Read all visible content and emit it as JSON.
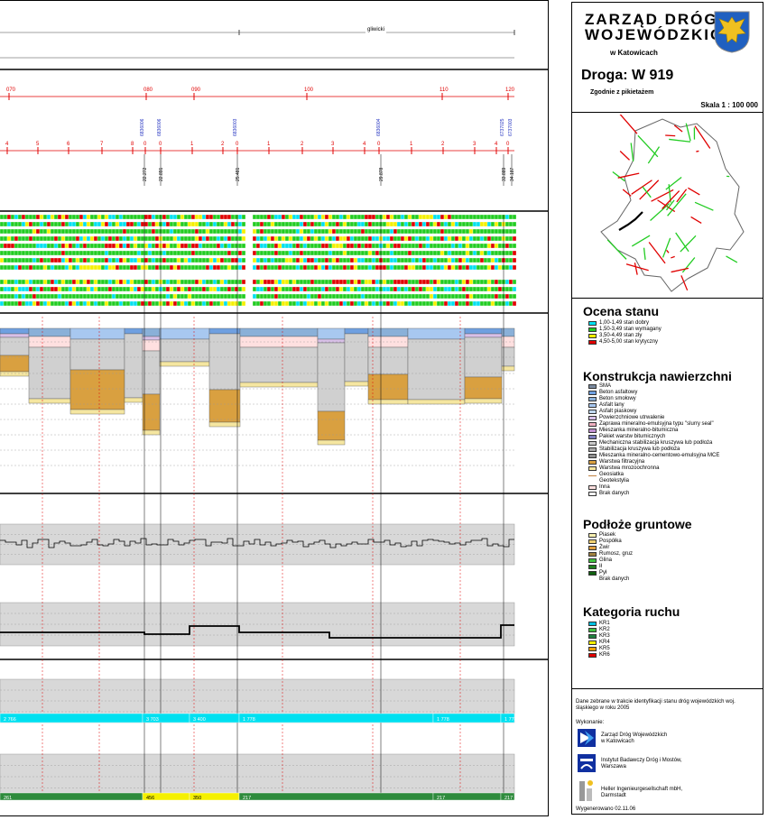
{
  "header": {
    "road_name": "gliwicki"
  },
  "stations": [
    "070",
    "080",
    "090",
    "100",
    "110",
    "120"
  ],
  "refpoints": [
    "6836006",
    "6836006",
    "6836003",
    "6836004",
    "6737025",
    "6737003"
  ],
  "km_ticks": [
    "4",
    "5",
    "6",
    "7",
    "8",
    "0",
    "0",
    "1",
    "2",
    "0",
    "1",
    "2",
    "3",
    "4",
    "0",
    "1",
    "2",
    "3",
    "4",
    "0"
  ],
  "distances": [
    "22.272",
    "22.891",
    "25.481",
    "29.878",
    "33.889",
    "34.187"
  ],
  "traffic_values": [
    {
      "label": "2 766",
      "color": "#00e0f0"
    },
    {
      "label": "3 703",
      "color": "#00e0f0"
    },
    {
      "label": "3 400",
      "color": "#00e0f0"
    },
    {
      "label": "1 778",
      "color": "#00e0f0"
    },
    {
      "label": "1 778",
      "color": "#00e0f0"
    },
    {
      "label": "1 778",
      "color": "#00e0f0"
    }
  ],
  "heavy_values": [
    {
      "label": "261",
      "color": "#2e8b3c"
    },
    {
      "label": "456",
      "color": "#f5f000"
    },
    {
      "label": "350",
      "color": "#f5f000"
    },
    {
      "label": "217",
      "color": "#2e8b3c"
    },
    {
      "label": "217",
      "color": "#2e8b3c"
    },
    {
      "label": "217",
      "color": "#2e8b3c"
    }
  ],
  "legend": {
    "org_line1": "ZARZĄD  DRÓG",
    "org_line2": "WOJEWÓDZKICH",
    "org_city": "w Katowicach",
    "road_title": "Droga:  W 919",
    "chainage_note": "Zgodnie z pikietażem",
    "scale": "Skala 1 : 100 000",
    "condition": {
      "title": "Ocena stanu",
      "items": [
        {
          "label": "1,00-1,49 stan dobry",
          "color": "#00e0f0"
        },
        {
          "label": "1,50-3,49 stan wymagany",
          "color": "#22cc22"
        },
        {
          "label": "3,50-4,49 stan zły",
          "color": "#f5f000"
        },
        {
          "label": "4,50-5,00 stan krytyczny",
          "color": "#e00000"
        }
      ]
    },
    "construction": {
      "title": "Konstrukcja nawierzchni",
      "items": [
        {
          "label": "SMA",
          "color": "#7a8aa0"
        },
        {
          "label": "Beton asfaltowy",
          "color": "#6fa0e0"
        },
        {
          "label": "Beton smołowy",
          "color": "#8ab0d8"
        },
        {
          "label": "Asfalt lany",
          "color": "#a8c8f0"
        },
        {
          "label": "Asfalt piaskowy",
          "color": "#c0d8f0"
        },
        {
          "label": "Powierzchniowe utrwalenie",
          "color": "#d8c0e8"
        },
        {
          "label": "Zaprawa mineralno-emulsyjna typu \"slurry seal\"",
          "color": "#f0b0c0"
        },
        {
          "label": "Mieszanka mineralno-bitumiczna",
          "color": "#c090d0"
        },
        {
          "label": "Pakiet warstw bitumicznych",
          "color": "#8080c0"
        },
        {
          "label": "Mechaniczna stabilizacja kruszywa lub podłoża",
          "color": "#c8c8c8"
        },
        {
          "label": "Stabilizacja kruszywa lub podłoża",
          "color": "#a8a8a8"
        },
        {
          "label": "Mieszanka mineralno-cementowo-emulsyjna MCE",
          "color": "#909090"
        },
        {
          "label": "Warstwa filtracyjna",
          "color": "#d9a040"
        },
        {
          "label": "Warstwa mrozoochronna",
          "color": "#f5e6a0"
        },
        {
          "label": "Geosiatka",
          "color": "line"
        },
        {
          "label": "Geotekstylia",
          "color": "none"
        },
        {
          "label": "Inna",
          "color": "#ffe0e0"
        },
        {
          "label": "Brak danych",
          "color": "#ffffff"
        }
      ]
    },
    "subgrade": {
      "title": "Podłoże gruntowe",
      "items": [
        {
          "label": "Piasek",
          "color": "#f8f0b0"
        },
        {
          "label": "Pospółka",
          "color": "#f0d070"
        },
        {
          "label": "Żwir",
          "color": "#e0a040"
        },
        {
          "label": "Rumosz, gruz",
          "color": "#a08040"
        },
        {
          "label": "Glina",
          "color": "#40c040"
        },
        {
          "label": "Ił",
          "color": "#208020"
        },
        {
          "label": "Pył",
          "color": "#106010"
        },
        {
          "label": "Brak danych",
          "color": "none"
        }
      ]
    },
    "traffic": {
      "title": "Kategoria ruchu",
      "items": [
        {
          "label": "KR1",
          "color": "#00c0e0"
        },
        {
          "label": "KR2",
          "color": "#40c040"
        },
        {
          "label": "KR3",
          "color": "#208040"
        },
        {
          "label": "KR4",
          "color": "#f5f000"
        },
        {
          "label": "KR5",
          "color": "#f0a000"
        },
        {
          "label": "KR6",
          "color": "#e00000"
        }
      ]
    },
    "footer_note": "Dane zebrane w trakcie identyfikacji stanu dróg wojewódzkich woj. śląskiego w roku 2005",
    "executed_label": "Wykonanie:",
    "executors": [
      {
        "name": "Zarząd Dróg Wojewódzkich\nw Katowicach",
        "icon": "zdw-logo-icon"
      },
      {
        "name": "Instytut Badawczy Dróg i Mostów,\nWarszawa",
        "icon": "ibdim-logo-icon"
      },
      {
        "name": "Heller Ingenieurgesellschaft mbH,\nDarmstadt",
        "icon": "heller-logo-icon"
      }
    ],
    "generated": "Wygenerowano 02.11.06"
  },
  "colors": {
    "red": "#e00000",
    "green": "#22cc22",
    "cyan": "#00e0f0",
    "yellow": "#f5f000",
    "blue": "#2030c0",
    "gray": "#d0d0d0"
  }
}
